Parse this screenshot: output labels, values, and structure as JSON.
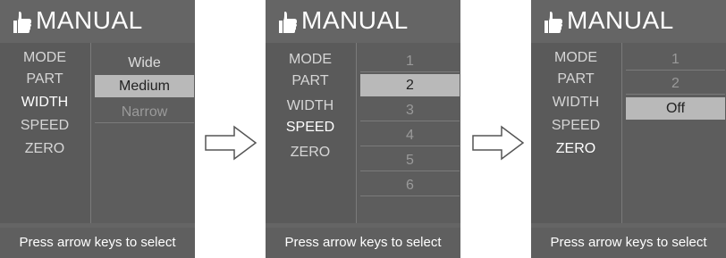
{
  "screens": [
    {
      "title": "MANUAL",
      "menu": [
        "MODE",
        "PART",
        "WIDTH",
        "SPEED",
        "ZERO"
      ],
      "active_menu": "WIDTH",
      "options": [
        "Wide",
        "Medium",
        "Narrow"
      ],
      "selected_option": "Medium",
      "footer": "Press arrow keys to select"
    },
    {
      "title": "MANUAL",
      "menu": [
        "MODE",
        "PART",
        "WIDTH",
        "SPEED",
        "ZERO"
      ],
      "active_menu": "SPEED",
      "options": [
        "1",
        "2",
        "3",
        "4",
        "5",
        "6"
      ],
      "selected_option": "2",
      "footer": "Press arrow keys to select"
    },
    {
      "title": "MANUAL",
      "menu": [
        "MODE",
        "PART",
        "WIDTH",
        "SPEED",
        "ZERO"
      ],
      "active_menu": "ZERO",
      "options": [
        "1",
        "2",
        "Off"
      ],
      "selected_option": "Off",
      "footer": "Press arrow keys to select"
    }
  ],
  "icons": {
    "title_icon": "thumbs-up-icon",
    "transition_icon": "right-arrow-icon"
  },
  "colors": {
    "screen_bg": "#656565",
    "selected_bg": "#b9b9b9"
  }
}
